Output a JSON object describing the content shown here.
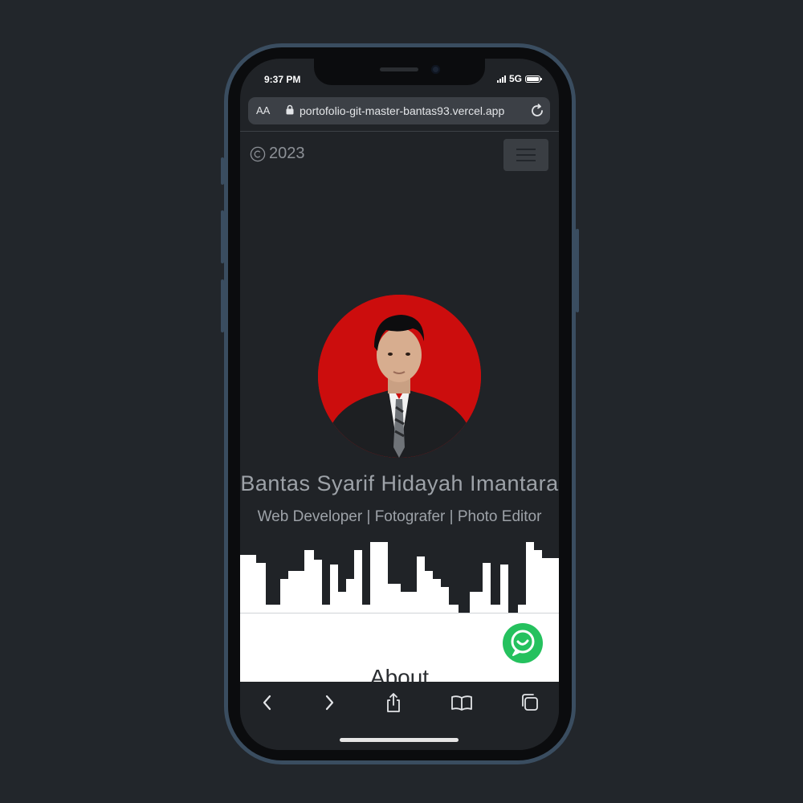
{
  "status_bar": {
    "time": "9:37 PM",
    "network": "5G"
  },
  "browser": {
    "text_size_label": "AA",
    "url": "portofolio-git-master-bantas93.vercel.app"
  },
  "header": {
    "copyright_year": "2023"
  },
  "hero": {
    "name": "Bantas Syarif Hidayah Imantara",
    "subtitle": "Web Developer | Fotografer | Photo Editor"
  },
  "about": {
    "title": "About"
  },
  "icons": {
    "copyright": "copyright-icon",
    "menu": "hamburger-menu-icon",
    "whatsapp": "whatsapp-icon",
    "back": "chevron-left-icon",
    "forward": "chevron-right-icon",
    "share": "share-icon",
    "bookmarks": "book-icon",
    "tabs": "tabs-icon",
    "lock": "lock-icon",
    "reload": "reload-icon"
  },
  "colors": {
    "background": "#22262b",
    "page_dark": "#202327",
    "avatar_background": "#cc0d0d",
    "whatsapp_green": "#25c15e",
    "phone_frame": "#3a4d60"
  }
}
